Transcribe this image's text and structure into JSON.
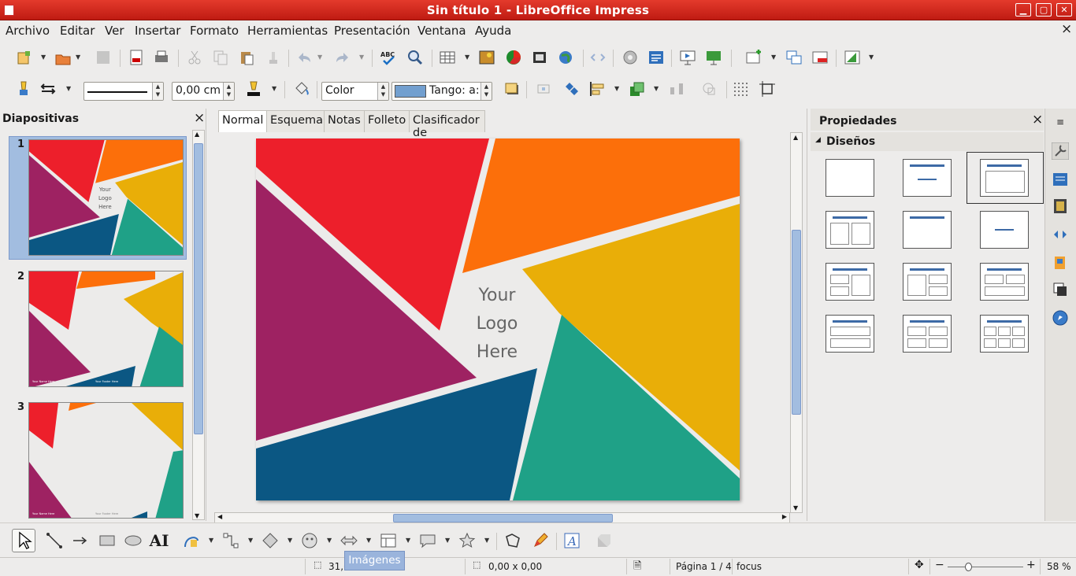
{
  "window": {
    "title": "Sin título 1 - LibreOffice Impress",
    "controls": [
      "▁",
      "▢",
      "✕"
    ]
  },
  "menubar": {
    "items": [
      "Archivo",
      "Editar",
      "Ver",
      "Insertar",
      "Formato",
      "Herramientas",
      "Presentación",
      "Ventana",
      "Ayuda"
    ],
    "close": "×"
  },
  "formatbar": {
    "line_width": "0,00 cm",
    "area_style": "Color",
    "area_fill": "Tango: a:"
  },
  "slides_pane": {
    "title": "Diapositivas",
    "close": "×",
    "slides": [
      {
        "number": "1",
        "logo": [
          "Your",
          "Logo",
          "Here"
        ]
      },
      {
        "number": "2",
        "footer_a": "Your Name Here",
        "footer_b": "Your Footer Here"
      },
      {
        "number": "3",
        "footer_a": "Your Name Here",
        "footer_b": "Your Footer Here"
      }
    ]
  },
  "view_tabs": [
    "Normal",
    "Esquema",
    "Notas",
    "Folleto",
    "Clasificador de diapositivas"
  ],
  "slide": {
    "logo_line1": "Your",
    "logo_line2": "Logo",
    "logo_line3": "Here"
  },
  "properties": {
    "title": "Propiedades",
    "close": "×",
    "section": "Diseños"
  },
  "statusbar": {
    "position": "31,0",
    "size": "0,00 x 0,00",
    "page": "Página 1 / 4",
    "master": "focus",
    "zoom": "58 %"
  },
  "tooltip": "Imágenes",
  "colors": {
    "titlebar": "#d42a1f",
    "red": "#ed1f2b",
    "orange": "#fc6f0a",
    "yellow": "#e9ae08",
    "purple": "#9e2262",
    "teal": "#1fa187",
    "blue": "#0b5783",
    "selection": "#a2bde0"
  }
}
